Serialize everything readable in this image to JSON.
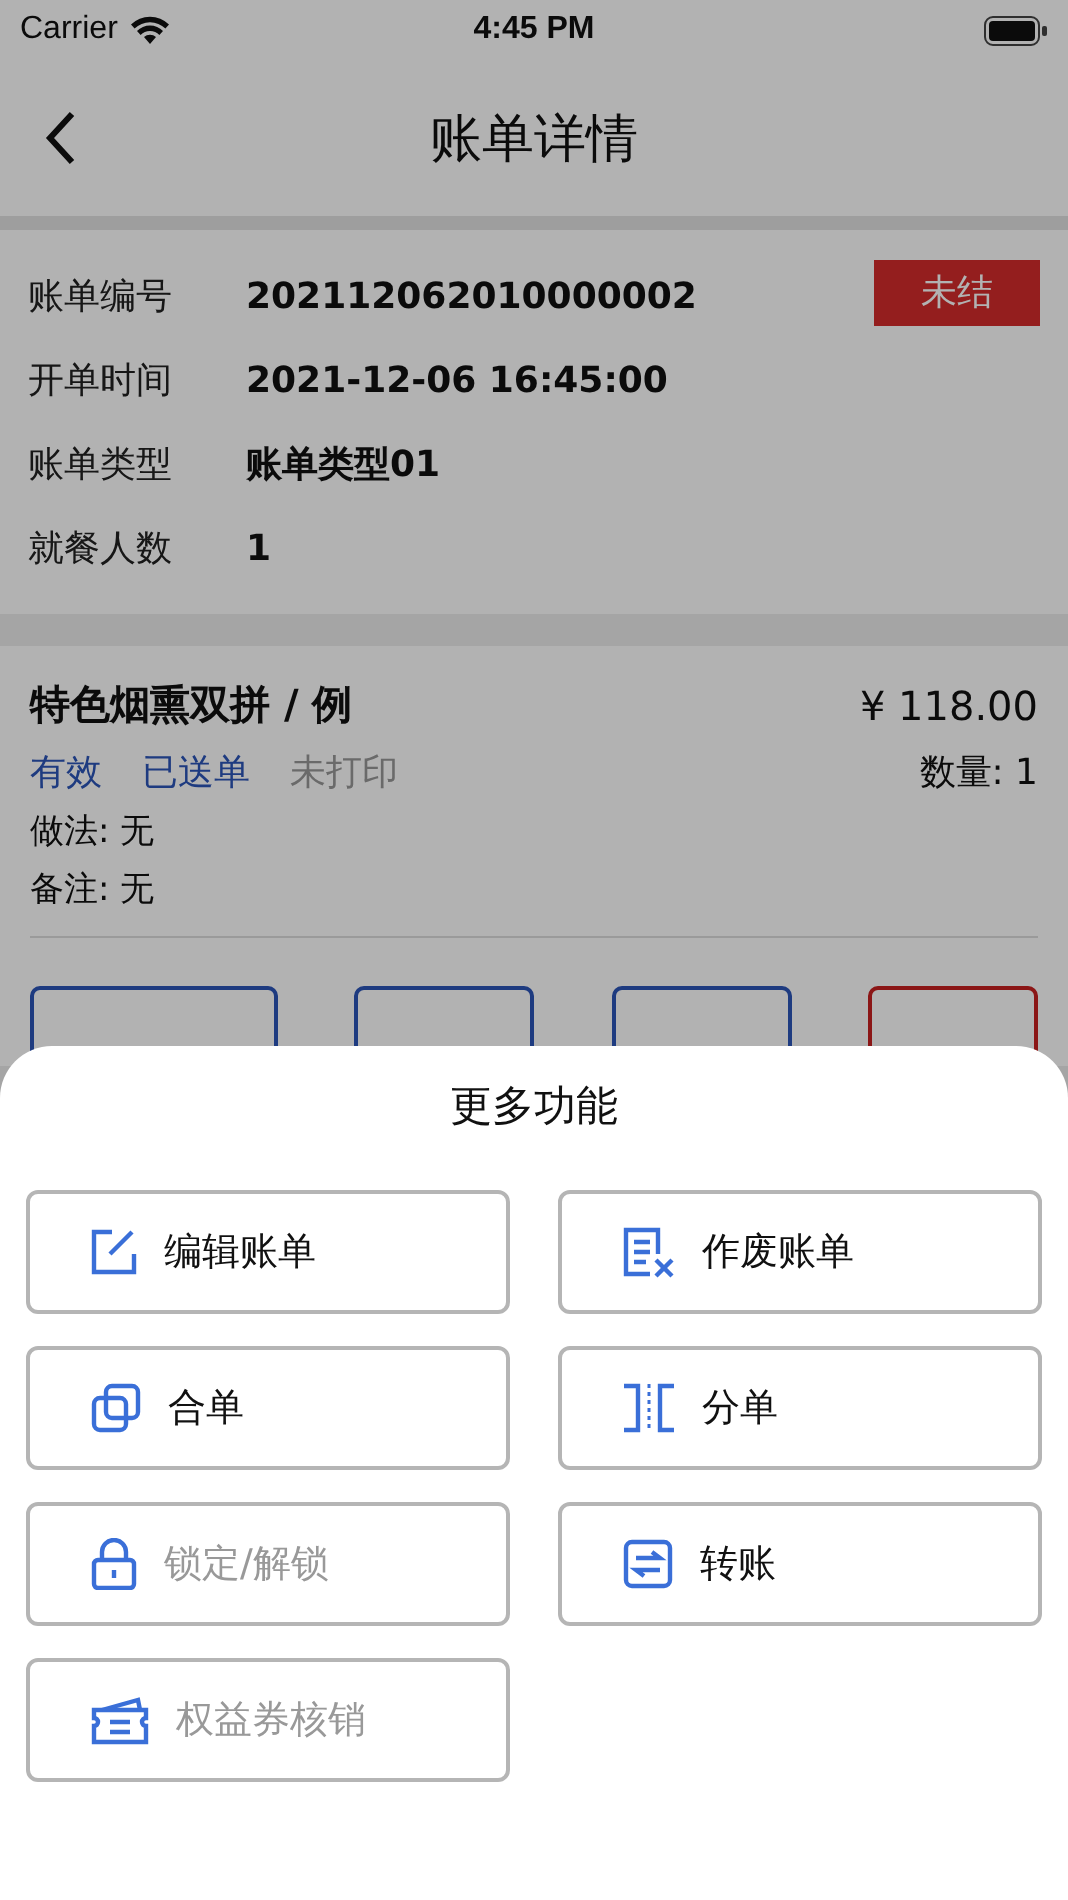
{
  "status_bar": {
    "carrier": "Carrier",
    "time": "4:45 PM"
  },
  "nav": {
    "title": "账单详情"
  },
  "bill": {
    "status": "未结",
    "fields": [
      {
        "label": "账单编号",
        "value": "202112062010000002"
      },
      {
        "label": "开单时间",
        "value": "2021-12-06 16:45:00"
      },
      {
        "label": "账单类型",
        "value": "账单类型01"
      },
      {
        "label": "就餐人数",
        "value": "1"
      }
    ]
  },
  "dish": {
    "name": "特色烟熏双拼 / 例",
    "price": "¥ 118.00",
    "quantity": "数量: 1",
    "tags": [
      {
        "label": "有效",
        "on": true
      },
      {
        "label": "已送单",
        "on": true
      },
      {
        "label": "未打印",
        "on": false
      }
    ],
    "notes": [
      "做法: 无",
      "备注: 无"
    ],
    "actions": [
      {
        "kind": "normal"
      },
      {
        "kind": "normal"
      },
      {
        "kind": "normal"
      },
      {
        "kind": "danger"
      }
    ]
  },
  "sheet": {
    "title": "更多功能",
    "items": [
      {
        "label": "编辑账单",
        "disabled": false
      },
      {
        "label": "作废账单",
        "disabled": false
      },
      {
        "label": "合单",
        "disabled": false
      },
      {
        "label": "分单",
        "disabled": false
      },
      {
        "label": "锁定/解锁",
        "disabled": true
      },
      {
        "label": "转账",
        "disabled": false
      },
      {
        "label": "权益券核销",
        "disabled": true
      }
    ]
  }
}
